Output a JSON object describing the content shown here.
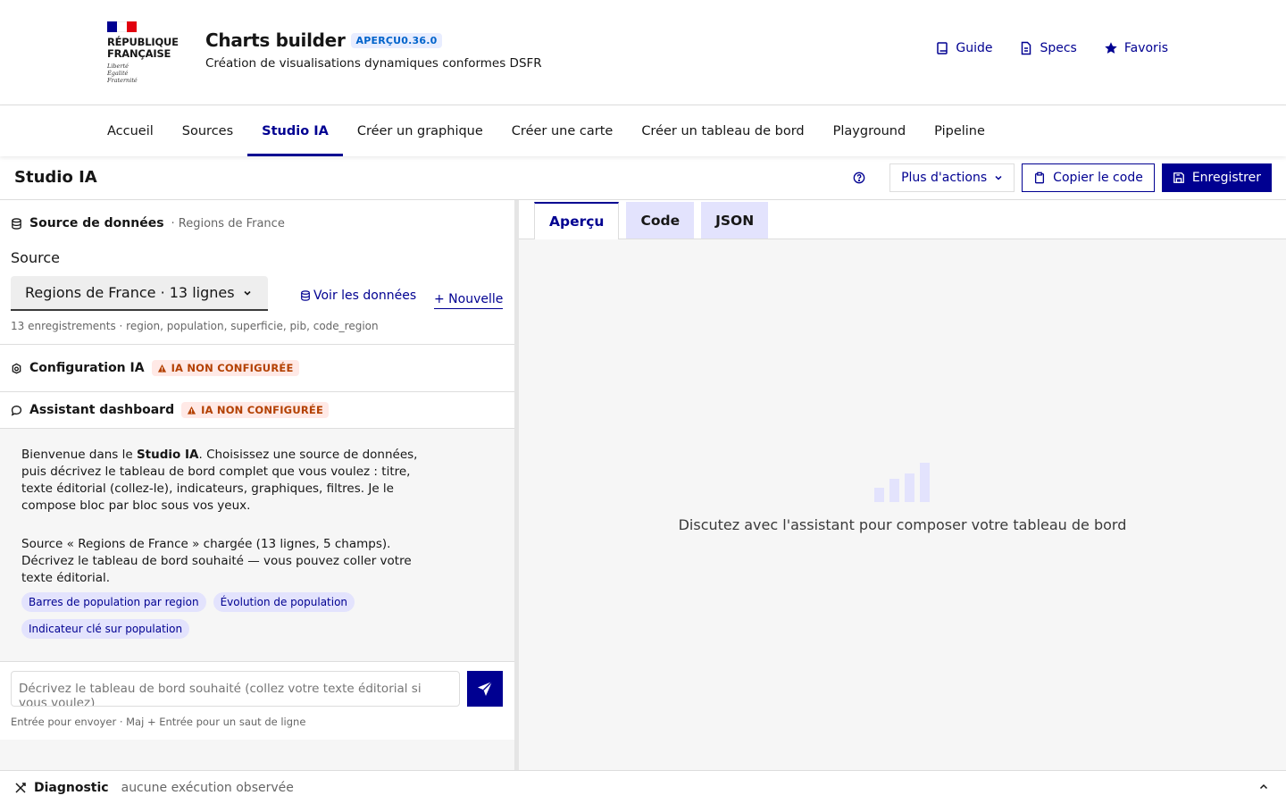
{
  "brand": {
    "logo_lines": [
      "RÉPUBLIQUE",
      "FRANÇAISE"
    ],
    "motto": [
      "Liberté",
      "Égalité",
      "Fraternité"
    ],
    "flag_colors": [
      "#000091",
      "#ffffff",
      "#e1000f"
    ]
  },
  "service": {
    "title": "Charts builder",
    "version_badge": "APERÇU0.36.0",
    "tagline": "Création de visualisations dynamiques conformes DSFR"
  },
  "tools": [
    {
      "label": "Guide",
      "icon": "book-icon"
    },
    {
      "label": "Specs",
      "icon": "file-text-icon"
    },
    {
      "label": "Favoris",
      "icon": "star-icon"
    }
  ],
  "nav": {
    "items": [
      "Accueil",
      "Sources",
      "Studio IA",
      "Créer un graphique",
      "Créer une carte",
      "Créer un tableau de bord",
      "Playground",
      "Pipeline"
    ],
    "active": "Studio IA"
  },
  "toolbar": {
    "title": "Studio IA",
    "more_actions": "Plus d'actions",
    "copy_code": "Copier le code",
    "save": "Enregistrer"
  },
  "source_section": {
    "title": "Source de données",
    "subtitle": "· Regions de France",
    "field_label": "Source",
    "selected": "Regions de France · 13 lignes",
    "view_data": "Voir les données",
    "new_label": "+ Nouvelle",
    "meta": "13 enregistrements · region, population, superficie, pib, code_region"
  },
  "ai_config": {
    "title": "Configuration IA",
    "badge": "IA NON CONFIGURÉE"
  },
  "assistant": {
    "title": "Assistant dashboard",
    "badge": "IA NON CONFIGURÉE",
    "welcome_pre": "Bienvenue dans le ",
    "welcome_bold": "Studio IA",
    "welcome_post": ". Choisissez une source de données, puis décrivez le tableau de bord complet que vous voulez : titre, texte éditorial (collez-le), indicateurs, graphiques, filtres. Je le compose bloc par bloc sous vos yeux.",
    "source_message": "Source « Regions de France » chargée (13 lignes, 5 champs). Décrivez le tableau de bord souhaité — vous pouvez coller votre texte éditorial.",
    "suggestions": [
      "Barres de population par region",
      "Évolution de population",
      "Indicateur clé sur population"
    ],
    "input_placeholder": "Décrivez le tableau de bord souhaité (collez votre texte éditorial si vous voulez)",
    "hint": "Entrée pour envoyer · Maj + Entrée pour un saut de ligne"
  },
  "preview": {
    "tabs": [
      "Aperçu",
      "Code",
      "JSON"
    ],
    "active_tab": "Aperçu",
    "empty_text": "Discutez avec l'assistant pour composer votre tableau de bord"
  },
  "diagnostic": {
    "title": "Diagnostic",
    "status": "aucune exécution observée"
  },
  "colors": {
    "primary": "#000091",
    "warning_text": "#b34000",
    "warning_bg": "#ffe9e6",
    "chip_bg": "#e3e3fd"
  }
}
